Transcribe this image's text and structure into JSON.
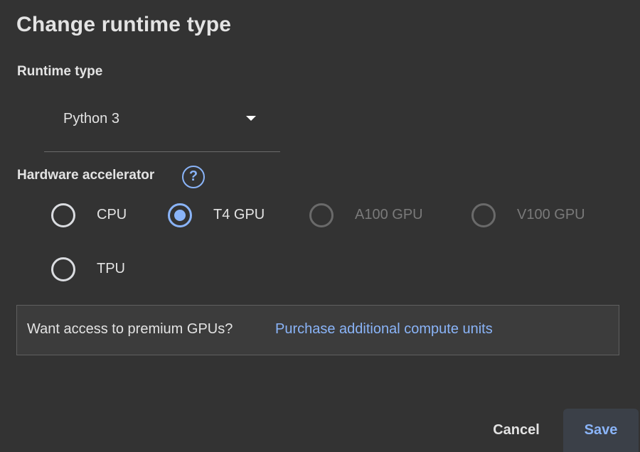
{
  "dialog": {
    "title": "Change runtime type"
  },
  "runtime": {
    "label": "Runtime type",
    "selected": "Python 3"
  },
  "hardware": {
    "label": "Hardware accelerator",
    "help_icon": "?",
    "options": [
      {
        "label": "CPU",
        "selected": false,
        "disabled": false
      },
      {
        "label": "T4 GPU",
        "selected": true,
        "disabled": false
      },
      {
        "label": "A100 GPU",
        "selected": false,
        "disabled": true
      },
      {
        "label": "V100 GPU",
        "selected": false,
        "disabled": true
      },
      {
        "label": "TPU",
        "selected": false,
        "disabled": false
      }
    ]
  },
  "premium": {
    "text": "Want access to premium GPUs?",
    "link": "Purchase additional compute units"
  },
  "actions": {
    "cancel": "Cancel",
    "save": "Save"
  },
  "colors": {
    "background": "#333333",
    "accent": "#8ab4f8",
    "text": "#e3e3e3",
    "disabled": "#7a7a7a"
  },
  "icons": {
    "dropdown": "caret-down-icon",
    "help": "help-circle-icon"
  }
}
